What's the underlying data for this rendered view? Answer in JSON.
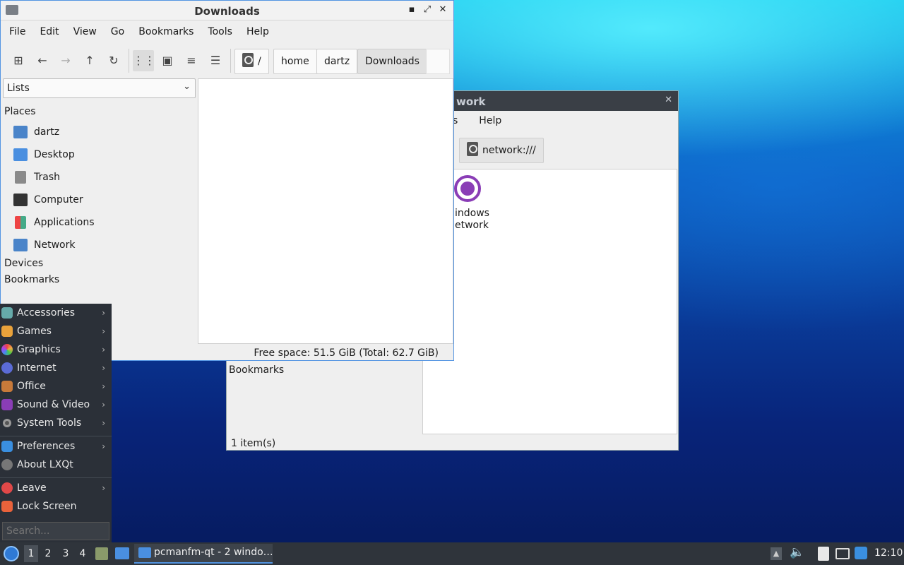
{
  "downloads_window": {
    "title": "Downloads",
    "controls": {
      "minimize": "▪",
      "maximize": "⤢",
      "close": "✕"
    },
    "menu": [
      "File",
      "Edit",
      "View",
      "Go",
      "Bookmarks",
      "Tools",
      "Help"
    ],
    "path": {
      "root": "/",
      "parts": [
        "home",
        "dartz",
        "Downloads"
      ]
    },
    "side_dropdown": "Lists",
    "places_header": "Places",
    "places": [
      "dartz",
      "Desktop",
      "Trash",
      "Computer",
      "Applications",
      "Network"
    ],
    "devices_header": "Devices",
    "bookmarks_header": "Bookmarks",
    "status": "Free space: 51.5 GiB (Total: 62.7 GiB)"
  },
  "network_window": {
    "title_partial": "work",
    "menu_partial": [
      "s",
      "Help"
    ],
    "path": "network:///",
    "item_label_line1": "indows",
    "item_label_line2": "etwork",
    "bookmarks_header": "Bookmarks",
    "status": "1 item(s)"
  },
  "app_menu": {
    "items": [
      "Accessories",
      "Games",
      "Graphics",
      "Internet",
      "Office",
      "Sound & Video",
      "System Tools"
    ],
    "items2": [
      "Preferences",
      "About LXQt"
    ],
    "items3": [
      "Leave",
      "Lock Screen"
    ],
    "search_placeholder": "Search..."
  },
  "taskbar": {
    "desktops": [
      "1",
      "2",
      "3",
      "4"
    ],
    "task_label": "pcmanfm-qt - 2 windo…",
    "clock": "12:10"
  },
  "colors": {
    "accent": "#5294e2",
    "menu_bg": "#2b3038",
    "taskbar_bg": "#2f343b"
  }
}
